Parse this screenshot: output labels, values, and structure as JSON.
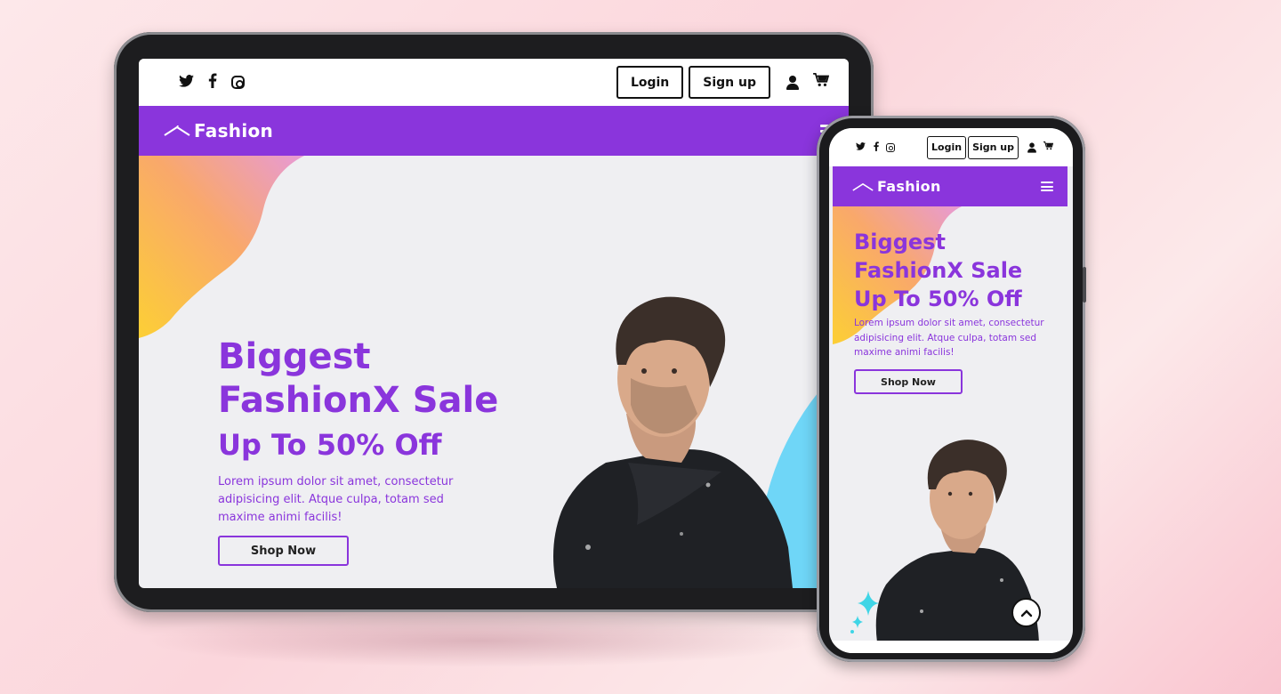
{
  "brand": {
    "name": "Fashion"
  },
  "social": [
    "twitter-icon",
    "facebook-icon",
    "instagram-icon"
  ],
  "header": {
    "login": "Login",
    "signup": "Sign up"
  },
  "hero": {
    "line1": "Biggest",
    "line2": "FashionX Sale",
    "line3": "Up To 50% Off",
    "body": "Lorem ipsum dolor sit amet, consectetur adipisicing elit. Atque culpa, totam sed maxime animi facilis!",
    "cta": "Shop Now"
  },
  "colors": {
    "accent": "#8a35dc",
    "background": "#efeff2",
    "blob_orange": "#f9a86b",
    "blob_pink": "#e79ad6",
    "blob_yellow": "#fccf35",
    "blob_blue": "#6fd6f7",
    "sparkle": "#3fd5e6"
  }
}
